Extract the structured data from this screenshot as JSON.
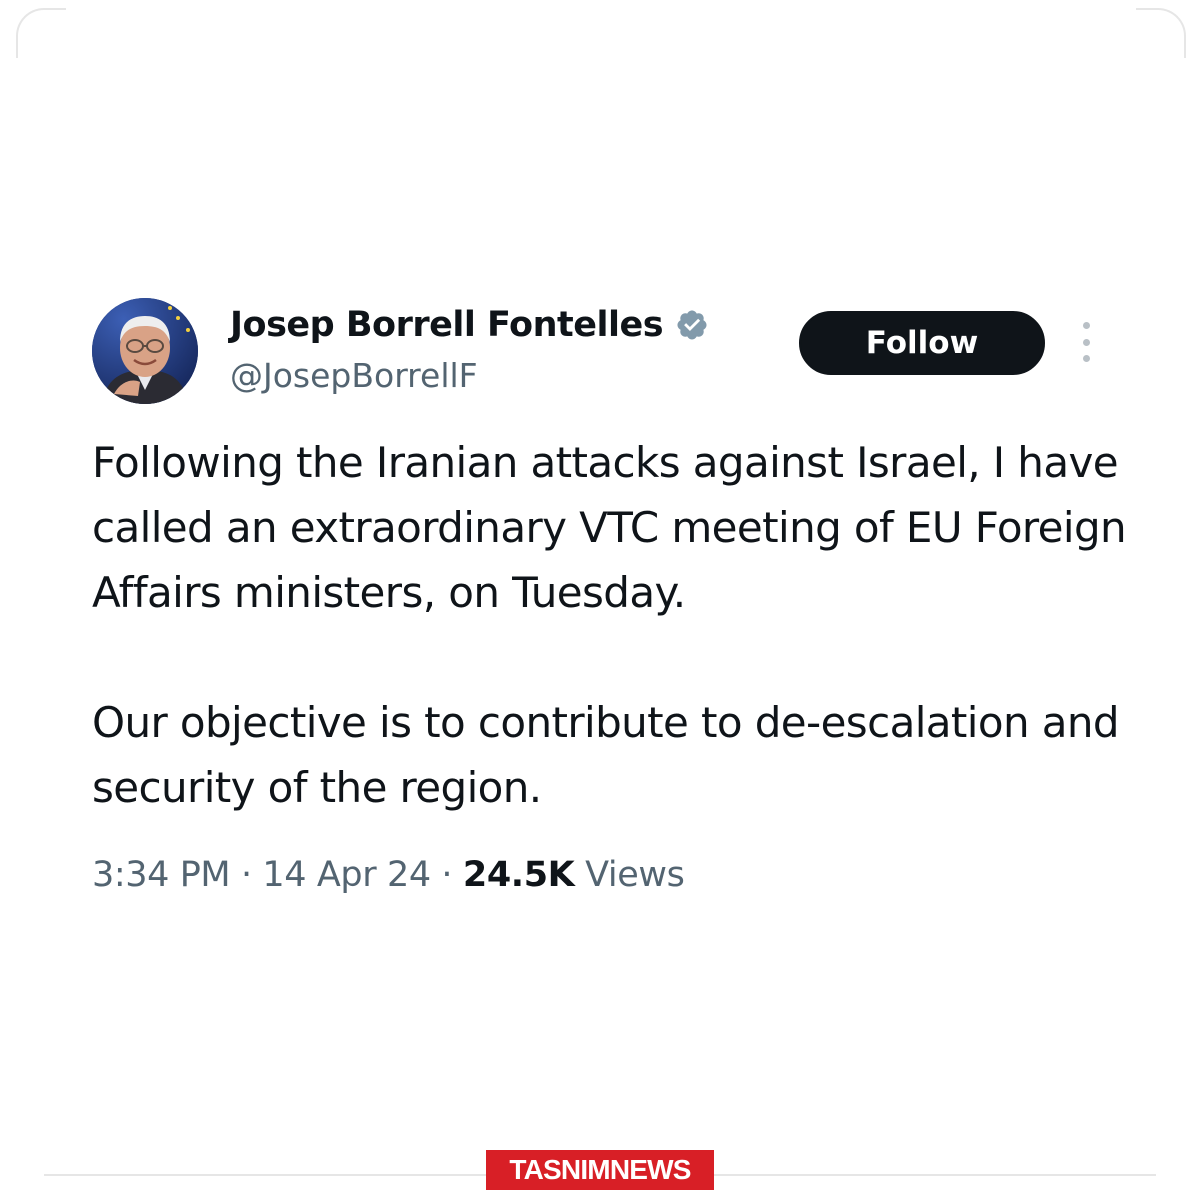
{
  "tweet": {
    "author": {
      "display_name": "Josep Borrell Fontelles",
      "handle": "@JosepBorrellF",
      "verified": true,
      "verified_badge_color": "#829aab"
    },
    "follow_button": {
      "label": "Follow",
      "background": "#0f1419",
      "text_color": "#ffffff"
    },
    "more_menu": {
      "icon": "more-vertical-icon"
    },
    "body": {
      "paragraphs": [
        "Following the Iranian attacks against Israel, I have called an extraordinary VTC meeting of EU Foreign Affairs ministers, on Tuesday.",
        "Our objective is to contribute to de-escalation and security of the region."
      ]
    },
    "meta": {
      "time": "3:34 PM",
      "separator": " · ",
      "date": "14 Apr 24",
      "views_count": "24.5K",
      "views_label": "Views"
    }
  },
  "watermark": {
    "text": "TASNIMNEWS",
    "background": "#d81f26"
  },
  "colors": {
    "text_primary": "#0f1419",
    "text_secondary": "#536471"
  }
}
